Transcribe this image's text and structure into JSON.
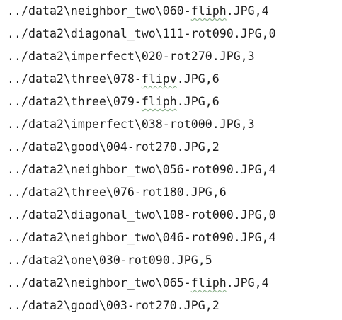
{
  "lines": [
    {
      "before": "../data2\\neighbor_two\\060-",
      "typo": "fliph",
      "after": ".JPG,4"
    },
    {
      "before": "../data2\\diagonal_two\\111-rot090.JPG,0",
      "typo": "",
      "after": ""
    },
    {
      "before": "../data2\\imperfect\\020-rot270.JPG,3",
      "typo": "",
      "after": ""
    },
    {
      "before": "../data2\\three\\078-",
      "typo": "flipv",
      "after": ".JPG,6"
    },
    {
      "before": "../data2\\three\\079-",
      "typo": "fliph",
      "after": ".JPG,6"
    },
    {
      "before": "../data2\\imperfect\\038-rot000.JPG,3",
      "typo": "",
      "after": ""
    },
    {
      "before": "../data2\\good\\004-rot270.JPG,2",
      "typo": "",
      "after": ""
    },
    {
      "before": "../data2\\neighbor_two\\056-rot090.JPG,4",
      "typo": "",
      "after": ""
    },
    {
      "before": "../data2\\three\\076-rot180.JPG,6",
      "typo": "",
      "after": ""
    },
    {
      "before": "../data2\\diagonal_two\\108-rot000.JPG,0",
      "typo": "",
      "after": ""
    },
    {
      "before": "../data2\\neighbor_two\\046-rot090.JPG,4",
      "typo": "",
      "after": ""
    },
    {
      "before": "../data2\\one\\030-rot090.JPG,5",
      "typo": "",
      "after": ""
    },
    {
      "before": "../data2\\neighbor_two\\065-",
      "typo": "fliph",
      "after": ".JPG,4"
    },
    {
      "before": "../data2\\good\\003-rot270.JPG,2",
      "typo": "",
      "after": ""
    }
  ]
}
